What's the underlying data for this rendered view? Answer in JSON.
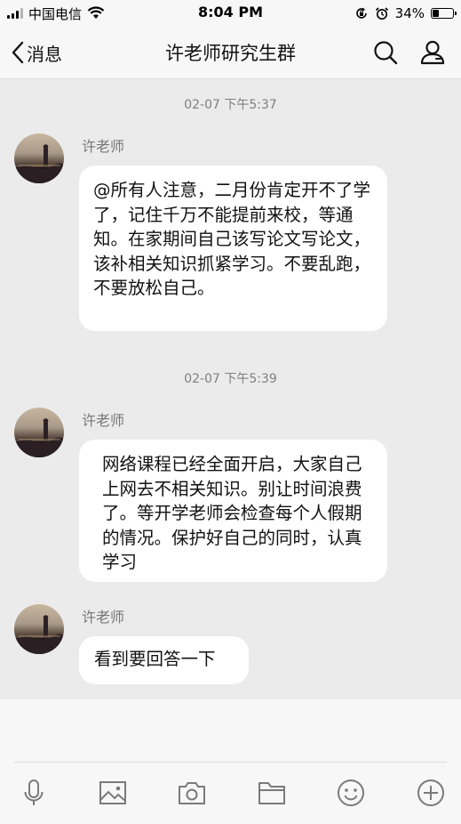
{
  "status_bar": {
    "carrier": "中国电信",
    "time": "8:04 PM",
    "battery_percent": "34%",
    "battery_level": 0.34
  },
  "nav": {
    "back_label": "消息",
    "title": "许老师研究生群"
  },
  "messages": [
    {
      "timestamp": "02-07 下午5:37",
      "sender": "许老师",
      "text": "@所有人注意，二月份肯定开不了学了，记住千万不能提前来校，等通知。在家期间自己该写论文写论文，该补相关知识抓紧学习。不要乱跑，不要放松自己。"
    },
    {
      "timestamp": "02-07 下午5:39",
      "sender": "许老师",
      "text": "网络课程已经全面开启，大家自己上网去不相关知识。别让时间浪费了。等开学老师会检查每个人假期的情况。保护好自己的同时，认真学习"
    },
    {
      "sender": "许老师",
      "text": "看到要回答一下"
    }
  ],
  "toolbar": {
    "icons": [
      "microphone-icon",
      "image-icon",
      "camera-icon",
      "folder-icon",
      "emoji-icon",
      "plus-icon"
    ]
  }
}
